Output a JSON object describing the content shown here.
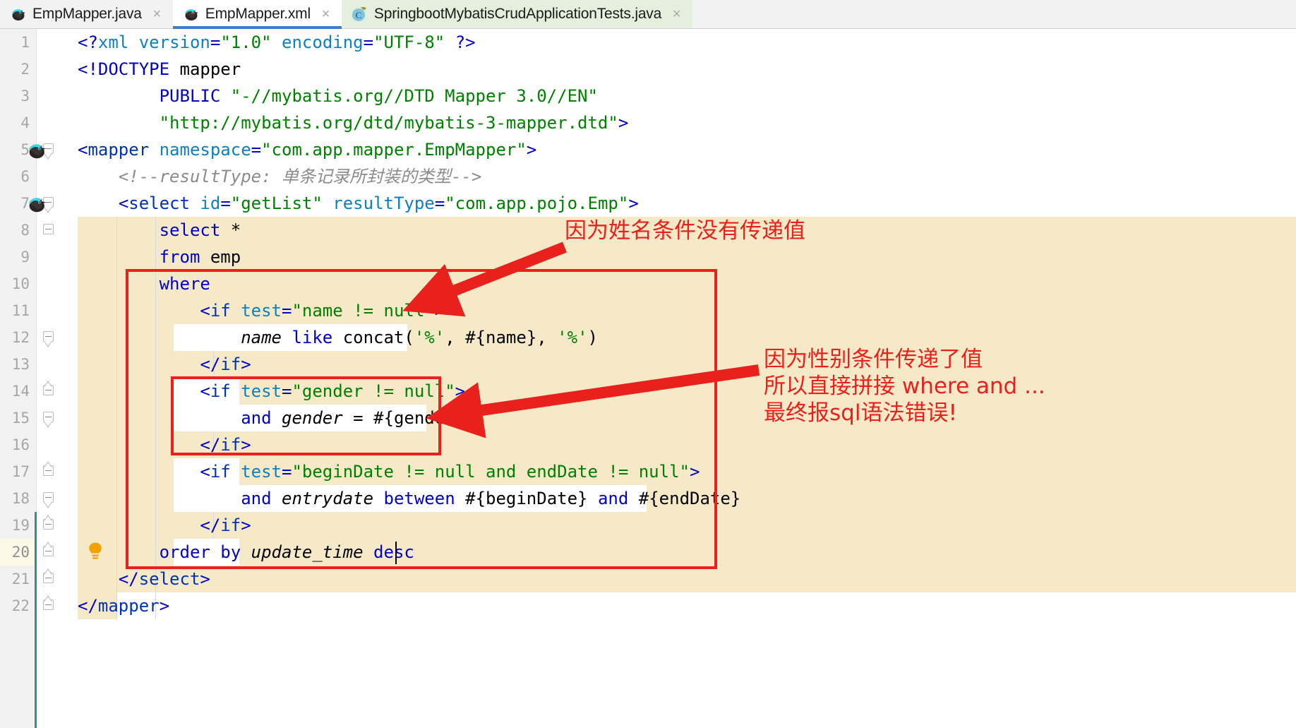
{
  "window": {
    "app": "IntelliJ IDEA",
    "theme": "light"
  },
  "tabs": [
    {
      "label": "EmpMapper.java",
      "icon": "mybatis-bird-icon",
      "close": "×",
      "state": "inactive"
    },
    {
      "label": "EmpMapper.xml",
      "icon": "mybatis-bird-icon",
      "close": "×",
      "state": "active"
    },
    {
      "label": "SpringbootMybatisCrudApplicationTests.java",
      "icon": "java-test-class-icon",
      "close": "×",
      "state": "testfile"
    }
  ],
  "gutter": {
    "line_numbers": [
      "1",
      "2",
      "3",
      "4",
      "5",
      "6",
      "7",
      "8",
      "9",
      "10",
      "11",
      "12",
      "13",
      "14",
      "15",
      "16",
      "17",
      "18",
      "19",
      "20",
      "21",
      "22"
    ],
    "current_line": "20",
    "icons": [
      {
        "name": "mybatis-statement-icon",
        "line": 5
      },
      {
        "name": "mybatis-statement-icon",
        "line": 7
      },
      {
        "name": "intention-bulb-icon",
        "line": 20
      }
    ]
  },
  "code": {
    "language": "xml",
    "lines": [
      {
        "n": 1,
        "text": "<?xml version=\"1.0\" encoding=\"UTF-8\" ?>"
      },
      {
        "n": 2,
        "text": "<!DOCTYPE mapper"
      },
      {
        "n": 3,
        "text": "        PUBLIC \"-//mybatis.org//DTD Mapper 3.0//EN\""
      },
      {
        "n": 4,
        "text": "        \"http://mybatis.org/dtd/mybatis-3-mapper.dtd\">"
      },
      {
        "n": 5,
        "text": "<mapper namespace=\"com.app.mapper.EmpMapper\">"
      },
      {
        "n": 6,
        "text": "    <!--resultType: 单条记录所封装的类型-->"
      },
      {
        "n": 7,
        "text": "    <select id=\"getList\" resultType=\"com.app.pojo.Emp\">"
      },
      {
        "n": 8,
        "text": "        select *"
      },
      {
        "n": 9,
        "text": "        from emp"
      },
      {
        "n": 10,
        "text": "        where"
      },
      {
        "n": 11,
        "text": "            <if test=\"name != null\">"
      },
      {
        "n": 12,
        "text": "                name like concat('%', #{name}, '%')"
      },
      {
        "n": 13,
        "text": "            </if>"
      },
      {
        "n": 14,
        "text": "            <if test=\"gender != null\">"
      },
      {
        "n": 15,
        "text": "                and gender = #{gender}"
      },
      {
        "n": 16,
        "text": "            </if>"
      },
      {
        "n": 17,
        "text": "            <if test=\"beginDate != null and endDate != null\">"
      },
      {
        "n": 18,
        "text": "                and entrydate between #{beginDate} and #{endDate}"
      },
      {
        "n": 19,
        "text": "            </if>"
      },
      {
        "n": 20,
        "text": "        order by update_time desc"
      },
      {
        "n": 21,
        "text": "    </select>"
      },
      {
        "n": 22,
        "text": "</mapper>"
      }
    ]
  },
  "annotations": [
    {
      "id": "name-annotation",
      "text": "因为姓名条件没有传递值",
      "color": "#e8211c",
      "points_to": "line-11-if-name-tag"
    },
    {
      "id": "gender-annotation",
      "lines": [
        "因为性别条件传递了值",
        "所以直接拼接 where and ...",
        "最终报sql语法错误!"
      ],
      "color": "#e8211c",
      "points_to": "line-15-and-gender"
    }
  ],
  "highlight_boxes": [
    {
      "id": "where-block-box",
      "color": "#e8211c",
      "covers": "lines 10-20"
    },
    {
      "id": "gender-if-box",
      "color": "#e8211c",
      "covers": "lines 14-16"
    }
  ],
  "colors": {
    "selection": "#f5e9c8",
    "tab_active": "#ffffff",
    "tab_test": "#e4efdd",
    "tab_underline": "#3a7cd8",
    "gutter": "#f2f2f2",
    "annotation_red": "#e8211c",
    "xml_tag": "#0000c8",
    "xml_attr": "#0e7fc1",
    "xml_value": "#008000",
    "comment": "#8c8c8c",
    "vcs_changed": "#3a8e7e",
    "bulb": "#f0a202"
  }
}
